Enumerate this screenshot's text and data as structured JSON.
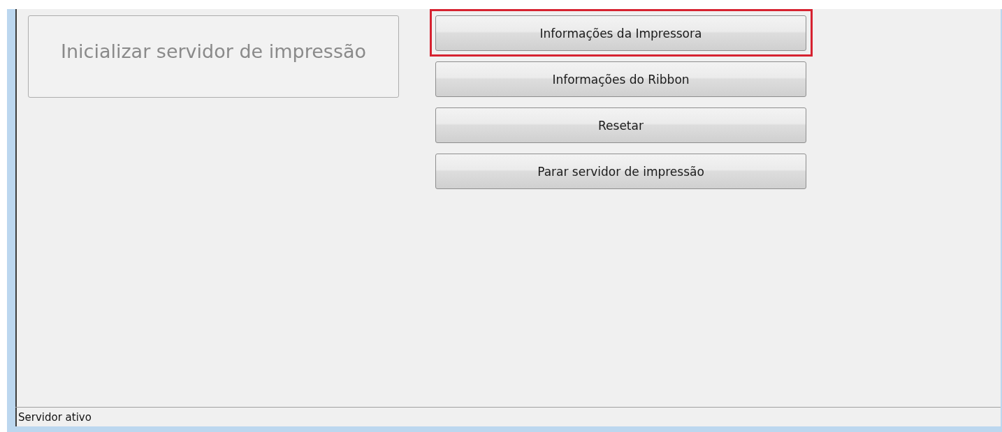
{
  "start_button": {
    "label": "Inicializar servidor de impressão",
    "disabled": true
  },
  "buttons": [
    {
      "label": "Informações da Impressora",
      "highlighted": true
    },
    {
      "label": "Informações do Ribbon",
      "highlighted": false
    },
    {
      "label": "Resetar",
      "highlighted": false
    },
    {
      "label": "Parar servidor de impressão",
      "highlighted": false
    }
  ],
  "status_bar": {
    "text": "Servidor ativo"
  }
}
